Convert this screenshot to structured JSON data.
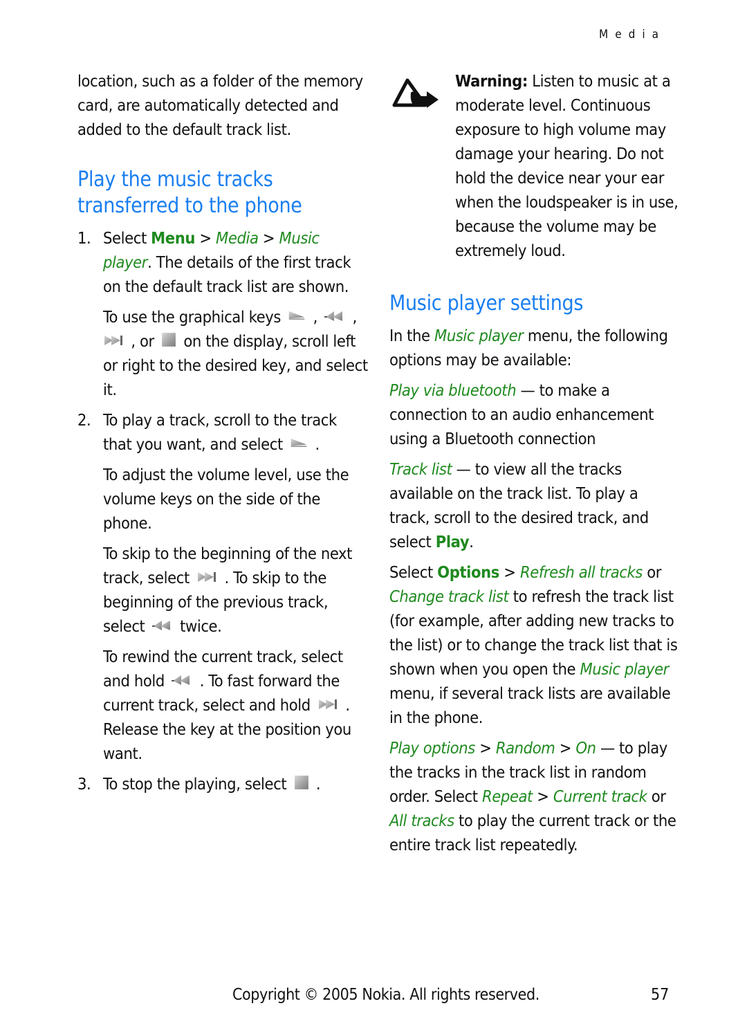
{
  "header": {
    "section": "Media"
  },
  "left": {
    "intro": "location, such as a folder of the memory card, are automatically detected and added to the default track list.",
    "heading": "Play the music tracks transferred to the phone",
    "steps": [
      {
        "num": "1.",
        "t1": "Select ",
        "menu": "Menu",
        "sep1": " > ",
        "media": "Media",
        "sep2": " > ",
        "music_player": "Music player",
        "t2": ". The details of the first track on the default track list are shown.",
        "sub": {
          "t1": "To use the graphical keys ",
          "c1": " , ",
          "c2": " ,",
          "c3": " , or ",
          "t2": " on the display, scroll left or right to the desired key, and select it."
        }
      },
      {
        "num": "2.",
        "t1": "To play a track, scroll to the track that you want, and select ",
        "t2": " .",
        "sub1": "To adjust the volume level, use the volume keys on the side of the phone.",
        "sub2": {
          "t1": "To skip to the beginning of the next track, select ",
          "t2": " . To skip to the beginning of the previous track, select ",
          "t3": " twice."
        },
        "sub3": {
          "t1": "To rewind the current track, select and hold ",
          "t2": " . To fast forward the current track, select and hold ",
          "t3": " . Release the key at the position you want."
        }
      },
      {
        "num": "3.",
        "t1": "To stop the playing, select ",
        "t2": " ."
      }
    ],
    "icons": [
      "play-icon",
      "rewind-icon",
      "forward-icon",
      "stop-icon"
    ]
  },
  "right": {
    "warning": {
      "icon": "warning-icon",
      "label": "Warning:",
      "text": " Listen to music at a moderate level. Continuous exposure to high volume may damage your hearing. Do not hold the device near your ear when the loudspeaker is in use, because the volume may be extremely loud."
    },
    "heading": "Music player settings",
    "intro": {
      "t1": "In the ",
      "link": "Music player",
      "t2": " menu, the following options may be available:"
    },
    "bluetooth": {
      "label": "Play via bluetooth",
      "text": " — to make a connection to an audio enhancement using a Bluetooth connection"
    },
    "tracklist": {
      "label": "Track list",
      "text": " — to view all the tracks available on the track list. To play a track, scroll to the desired track, and select ",
      "play": "Play",
      "end": "."
    },
    "options": {
      "t1": "Select ",
      "options": "Options",
      "sep": " > ",
      "refresh": "Refresh all tracks",
      "t2": " or ",
      "change": "Change track list",
      "t3": " to refresh the track list (for example, after adding new tracks to the list) or to change the track list that is shown when you open the ",
      "music_player": "Music player",
      "t4": " menu, if several track lists are available in the phone."
    },
    "playopts": {
      "play_options": "Play options",
      "sep1": " > ",
      "random": "Random",
      "sep2": " > ",
      "on": "On",
      "t1": " — to play the tracks in the track list in random order. Select ",
      "repeat": "Repeat",
      "sep3": " > ",
      "current": "Current track",
      "t2": " or ",
      "all": "All tracks",
      "t3": " to play the current track or the entire track list repeatedly."
    }
  },
  "footer": {
    "copyright": "Copyright © 2005 Nokia. All rights reserved.",
    "page": "57"
  },
  "colors": {
    "heading": "#1a7ff0",
    "ui_term": "#1f8a1f",
    "text": "#111111"
  }
}
